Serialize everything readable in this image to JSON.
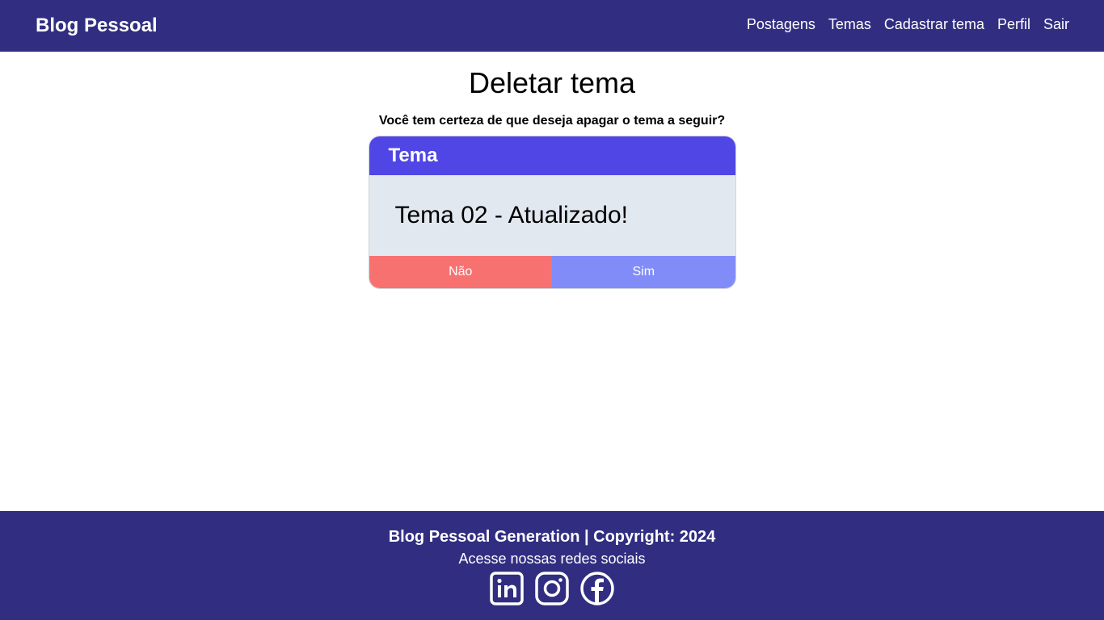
{
  "navbar": {
    "brand": "Blog Pessoal",
    "links": [
      "Postagens",
      "Temas",
      "Cadastrar tema",
      "Perfil",
      "Sair"
    ]
  },
  "main": {
    "title": "Deletar tema",
    "confirm_text": "Você tem certeza de que deseja apagar o tema a seguir?",
    "card": {
      "header": "Tema",
      "description": "Tema 02 - Atualizado!",
      "no_label": "Não",
      "yes_label": "Sim"
    }
  },
  "footer": {
    "copyright": "Blog Pessoal Generation | Copyright: 2024",
    "social_text": "Acesse nossas redes sociais",
    "icons": [
      "linkedin-icon",
      "instagram-icon",
      "facebook-icon"
    ]
  },
  "colors": {
    "navbar": "#312e81",
    "card_header": "#4f46e5",
    "card_body": "#e2e8f0",
    "no_button": "#f87171",
    "yes_button": "#818cf8"
  }
}
